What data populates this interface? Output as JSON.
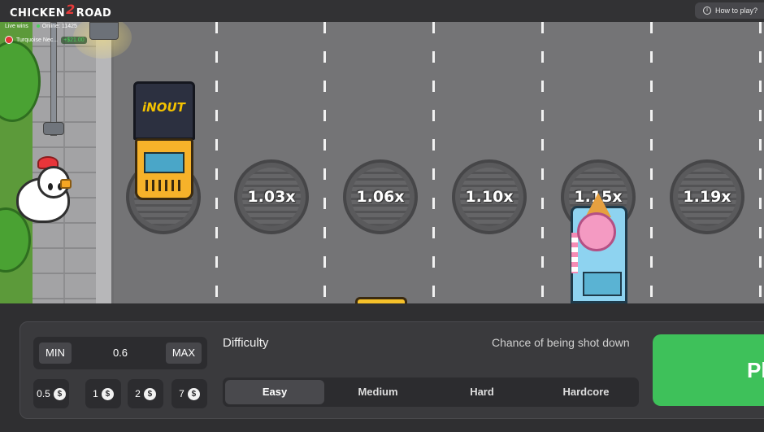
{
  "brand": {
    "logo_text_a": "CHICKEN",
    "logo_text_2": "2",
    "logo_text_b": "ROAD"
  },
  "header": {
    "how_to_play": "How to play?"
  },
  "live": {
    "live_wins": "Live wins",
    "online": "Online: 11425",
    "winner_name": "Turquoise Nec...",
    "winner_amount": "+$21.00"
  },
  "road": {
    "multipliers": [
      "1.03x",
      "1.06x",
      "1.10x",
      "1.15x",
      "1.19x"
    ],
    "truck_brand": "iNOUT"
  },
  "controls": {
    "min_label": "MIN",
    "max_label": "MAX",
    "bet_value": "0.6",
    "quick_bets": [
      "0.5",
      "1",
      "2",
      "7"
    ],
    "currency_icon": "$",
    "difficulty_label": "Difficulty",
    "chance_label": "Chance of being shot down",
    "difficulty_options": [
      "Easy",
      "Medium",
      "Hard",
      "Hardcore"
    ],
    "selected_difficulty": "Easy",
    "play_label": "Pl"
  },
  "colors": {
    "play_button": "#3ec15a",
    "road": "#747476",
    "panel": "#3a3a3d"
  }
}
